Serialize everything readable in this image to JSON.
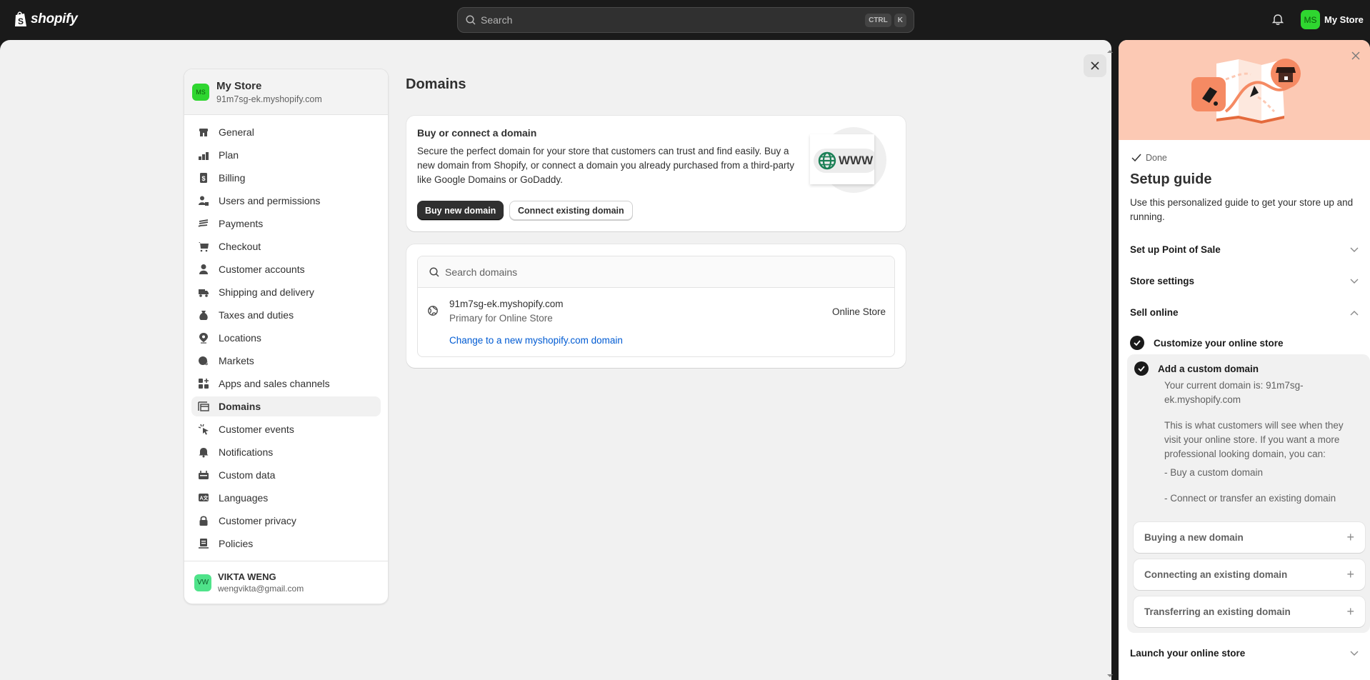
{
  "topbar": {
    "brand": "shopify",
    "search_placeholder": "Search",
    "shortcut_keys": [
      "CTRL",
      "K"
    ],
    "store_initials": "MS",
    "store_name": "My Store"
  },
  "settings_nav": {
    "store_initials": "MS",
    "store_name": "My Store",
    "store_domain": "91m7sg-ek.myshopify.com",
    "items": [
      {
        "label": "General",
        "icon": "store-icon"
      },
      {
        "label": "Plan",
        "icon": "plan-icon"
      },
      {
        "label": "Billing",
        "icon": "receipt-dollar-icon"
      },
      {
        "label": "Users and permissions",
        "icon": "users-lock-icon"
      },
      {
        "label": "Payments",
        "icon": "payments-hand-icon"
      },
      {
        "label": "Checkout",
        "icon": "cart-icon"
      },
      {
        "label": "Customer accounts",
        "icon": "person-icon"
      },
      {
        "label": "Shipping and delivery",
        "icon": "truck-icon"
      },
      {
        "label": "Taxes and duties",
        "icon": "tax-bag-icon"
      },
      {
        "label": "Locations",
        "icon": "location-pin-icon"
      },
      {
        "label": "Markets",
        "icon": "globe-dollar-icon"
      },
      {
        "label": "Apps and sales channels",
        "icon": "apps-icon"
      },
      {
        "label": "Domains",
        "icon": "domain-icon",
        "active": true
      },
      {
        "label": "Customer events",
        "icon": "cursor-click-icon"
      },
      {
        "label": "Notifications",
        "icon": "bell-icon"
      },
      {
        "label": "Custom data",
        "icon": "custom-data-icon"
      },
      {
        "label": "Languages",
        "icon": "translate-icon"
      },
      {
        "label": "Customer privacy",
        "icon": "lock-icon"
      },
      {
        "label": "Policies",
        "icon": "policy-icon"
      }
    ],
    "user_initials": "VW",
    "user_name": "VIKTA WENG",
    "user_email": "wengvikta@gmail.com"
  },
  "main": {
    "title": "Domains",
    "promo": {
      "heading": "Buy or connect a domain",
      "body": "Secure the perfect domain for your store that customers can trust and find easily. Buy a new domain from Shopify, or connect a domain you already purchased from a third-party like Google Domains or GoDaddy.",
      "buy_label": "Buy new domain",
      "connect_label": "Connect existing domain",
      "illustration_text": "WWW"
    },
    "domains": {
      "search_placeholder": "Search domains",
      "rows": [
        {
          "domain": "91m7sg-ek.myshopify.com",
          "subtitle": "Primary for Online Store",
          "channel": "Online Store",
          "action_link": "Change to a new myshopify.com domain"
        }
      ]
    }
  },
  "setup_guide": {
    "done_label": "Done",
    "title": "Setup guide",
    "subtitle": "Use this personalized guide to get your store up and running.",
    "sections": [
      {
        "label": "Set up Point of Sale",
        "expanded": false
      },
      {
        "label": "Store settings",
        "expanded": false
      },
      {
        "label": "Sell online",
        "expanded": true
      },
      {
        "label": "Launch your online store",
        "expanded": false
      }
    ],
    "tasks": [
      {
        "label": "Customize your online store",
        "completed": true
      },
      {
        "label": "Add a custom domain",
        "completed": true
      }
    ],
    "task_detail": {
      "current_domain": "Your current domain is: 91m7sg-ek.myshopify.com",
      "explanation": "This is what customers will see when they visit your online store. If you want a more professional looking domain, you can:",
      "option1": "- Buy a custom domain",
      "option2": "- Connect or transfer an existing domain"
    },
    "accordions": [
      {
        "label": "Buying a new domain"
      },
      {
        "label": "Connecting an existing domain"
      },
      {
        "label": "Transferring an existing domain"
      }
    ]
  },
  "colors": {
    "topbar_bg": "#1a1a1a",
    "avatar_store": "#2fd630",
    "avatar_user": "#4fe38a",
    "link": "#005bd3",
    "hero_bg": "#fcc9b4",
    "globe_green": "#1a7f55"
  }
}
